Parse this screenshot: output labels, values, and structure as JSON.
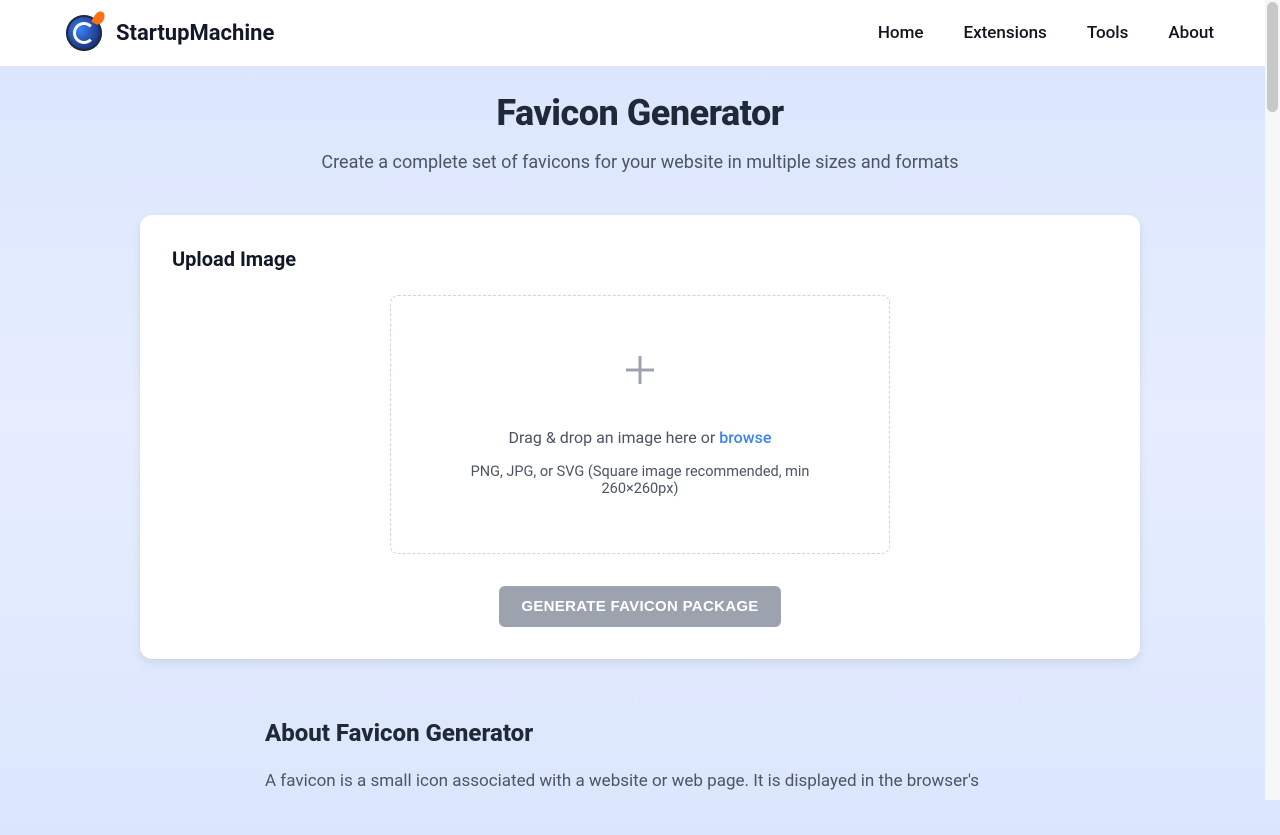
{
  "header": {
    "brand": "StartupMachine",
    "nav": {
      "home": "Home",
      "extensions": "Extensions",
      "tools": "Tools",
      "about": "About"
    }
  },
  "hero": {
    "title": "Favicon Generator",
    "subtitle": "Create a complete set of favicons for your website in multiple sizes and formats"
  },
  "upload": {
    "section_title": "Upload Image",
    "drop_text": "Drag & drop an image here or ",
    "browse_label": "browse",
    "hint": "PNG, JPG, or SVG (Square image recommended, min 260×260px)",
    "generate_button": "GENERATE FAVICON PACKAGE"
  },
  "about": {
    "title": "About Favicon Generator",
    "body": "A favicon is a small icon associated with a website or web page. It is displayed in the browser's"
  }
}
